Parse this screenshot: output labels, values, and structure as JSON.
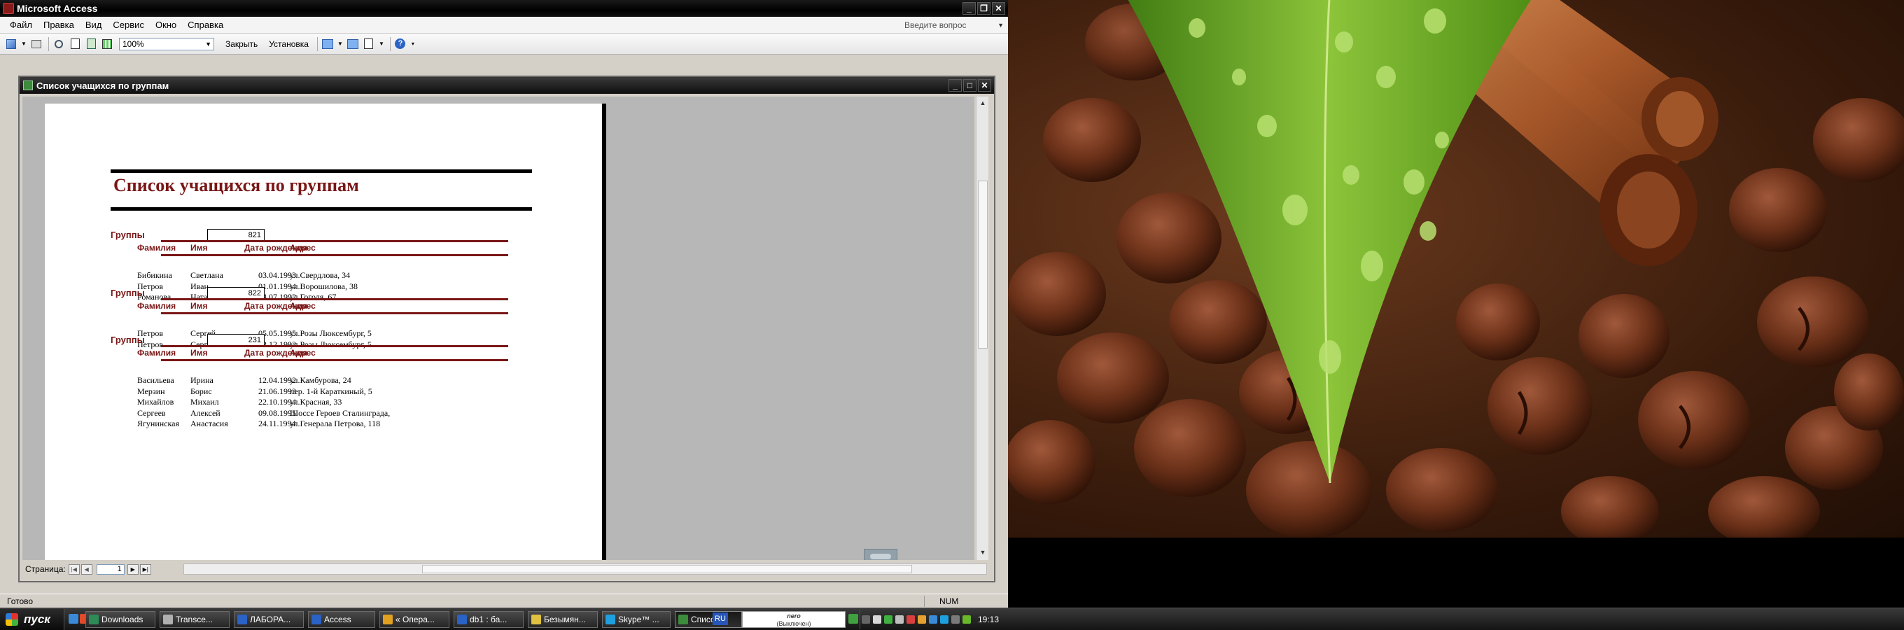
{
  "app": {
    "title": "Microsoft Access",
    "menu": [
      {
        "label": "Файл"
      },
      {
        "label": "Правка"
      },
      {
        "label": "Вид"
      },
      {
        "label": "Сервис"
      },
      {
        "label": "Окно"
      },
      {
        "label": "Справка"
      }
    ],
    "ask_placeholder": "Введите вопрос",
    "toolbar": {
      "zoom": "100%",
      "close_label": "Закрыть",
      "setup_label": "Установка"
    },
    "status": {
      "left": "Готово",
      "right": "NUM"
    }
  },
  "report_window": {
    "title": "Список учащихся по группам",
    "page_label": "Страница:",
    "page_number": "1"
  },
  "report": {
    "title": "Список учащихся по группам",
    "group_label": "Группы",
    "columns": [
      "Фамилия",
      "Имя",
      "Дата рождения",
      "Адрес"
    ],
    "groups": [
      {
        "code": "821",
        "rows": [
          [
            "Бибикина",
            "Светлана",
            "03.04.1993",
            "ул.Свердлова, 34"
          ],
          [
            "Петров",
            "Иван",
            "01.01.1994",
            "ул.Ворошилова, 38"
          ],
          [
            "Романова",
            "Наталья",
            "04.07.1992",
            "ул.Гоголя, 67"
          ]
        ]
      },
      {
        "code": "822",
        "rows": [
          [
            "Петров",
            "Сергей",
            "05.05.1995",
            "ул.Розы Люксембург, 5"
          ],
          [
            "Петров",
            "Сергей",
            "12.12.1993",
            "ул.Розы Люксембург, 5"
          ]
        ]
      },
      {
        "code": "231",
        "rows": [
          [
            "Васильева",
            "Ирина",
            "12.04.1992",
            "ул.Камбурова, 24"
          ],
          [
            "Мерзин",
            "Борис",
            "21.06.1993",
            "пер. 1-й Караткиный, 5"
          ],
          [
            "Михайлов",
            "Михаил",
            "22.10.1994",
            "ул.Красная, 33"
          ],
          [
            "Сергеев",
            "Алексей",
            "09.08.1995",
            "Шоссе Героев Сталинграда,"
          ],
          [
            "Ягунинская",
            "Анастасия",
            "24.11.1994",
            "ул.Генерала Петрова, 118"
          ]
        ]
      }
    ]
  },
  "taskbar": {
    "start_label": "пуск",
    "tasks": [
      {
        "label": "Downloads",
        "icon_color": "#2e8b57"
      },
      {
        "label": "Transce...",
        "icon_color": "#b0b0b0"
      },
      {
        "label": "ЛАБОРА...",
        "icon_color": "#2a62c6"
      },
      {
        "label": "Access",
        "icon_color": "#2a62c6"
      },
      {
        "label": "« Опера...",
        "icon_color": "#e0a020"
      },
      {
        "label": "db1 : ба...",
        "icon_color": "#2a62c6"
      },
      {
        "label": "Безымян...",
        "icon_color": "#e0c040"
      },
      {
        "label": "Skype™ ...",
        "icon_color": "#1ea0e0"
      },
      {
        "label": "Список ...",
        "icon_color": "#3c8c3c"
      }
    ],
    "language": "RU",
    "nero_line1": "nero",
    "nero_line2": "(Выключен)",
    "clock": "19:13"
  }
}
